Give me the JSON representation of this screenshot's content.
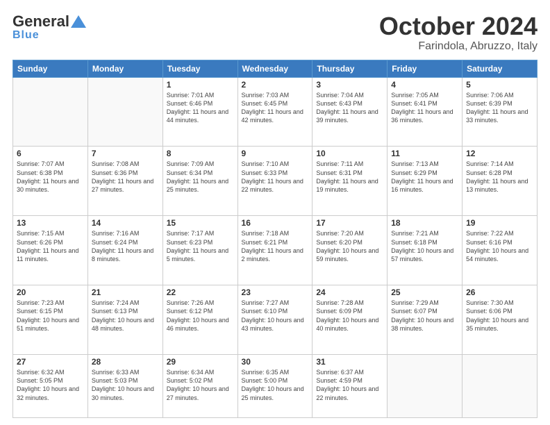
{
  "header": {
    "logo": {
      "line1": "General",
      "line2": "Blue"
    },
    "title": "October 2024",
    "subtitle": "Farindola, Abruzzo, Italy"
  },
  "weekdays": [
    "Sunday",
    "Monday",
    "Tuesday",
    "Wednesday",
    "Thursday",
    "Friday",
    "Saturday"
  ],
  "weeks": [
    [
      {
        "day": "",
        "info": ""
      },
      {
        "day": "",
        "info": ""
      },
      {
        "day": "1",
        "info": "Sunrise: 7:01 AM\nSunset: 6:46 PM\nDaylight: 11 hours and 44 minutes."
      },
      {
        "day": "2",
        "info": "Sunrise: 7:03 AM\nSunset: 6:45 PM\nDaylight: 11 hours and 42 minutes."
      },
      {
        "day": "3",
        "info": "Sunrise: 7:04 AM\nSunset: 6:43 PM\nDaylight: 11 hours and 39 minutes."
      },
      {
        "day": "4",
        "info": "Sunrise: 7:05 AM\nSunset: 6:41 PM\nDaylight: 11 hours and 36 minutes."
      },
      {
        "day": "5",
        "info": "Sunrise: 7:06 AM\nSunset: 6:39 PM\nDaylight: 11 hours and 33 minutes."
      }
    ],
    [
      {
        "day": "6",
        "info": "Sunrise: 7:07 AM\nSunset: 6:38 PM\nDaylight: 11 hours and 30 minutes."
      },
      {
        "day": "7",
        "info": "Sunrise: 7:08 AM\nSunset: 6:36 PM\nDaylight: 11 hours and 27 minutes."
      },
      {
        "day": "8",
        "info": "Sunrise: 7:09 AM\nSunset: 6:34 PM\nDaylight: 11 hours and 25 minutes."
      },
      {
        "day": "9",
        "info": "Sunrise: 7:10 AM\nSunset: 6:33 PM\nDaylight: 11 hours and 22 minutes."
      },
      {
        "day": "10",
        "info": "Sunrise: 7:11 AM\nSunset: 6:31 PM\nDaylight: 11 hours and 19 minutes."
      },
      {
        "day": "11",
        "info": "Sunrise: 7:13 AM\nSunset: 6:29 PM\nDaylight: 11 hours and 16 minutes."
      },
      {
        "day": "12",
        "info": "Sunrise: 7:14 AM\nSunset: 6:28 PM\nDaylight: 11 hours and 13 minutes."
      }
    ],
    [
      {
        "day": "13",
        "info": "Sunrise: 7:15 AM\nSunset: 6:26 PM\nDaylight: 11 hours and 11 minutes."
      },
      {
        "day": "14",
        "info": "Sunrise: 7:16 AM\nSunset: 6:24 PM\nDaylight: 11 hours and 8 minutes."
      },
      {
        "day": "15",
        "info": "Sunrise: 7:17 AM\nSunset: 6:23 PM\nDaylight: 11 hours and 5 minutes."
      },
      {
        "day": "16",
        "info": "Sunrise: 7:18 AM\nSunset: 6:21 PM\nDaylight: 11 hours and 2 minutes."
      },
      {
        "day": "17",
        "info": "Sunrise: 7:20 AM\nSunset: 6:20 PM\nDaylight: 10 hours and 59 minutes."
      },
      {
        "day": "18",
        "info": "Sunrise: 7:21 AM\nSunset: 6:18 PM\nDaylight: 10 hours and 57 minutes."
      },
      {
        "day": "19",
        "info": "Sunrise: 7:22 AM\nSunset: 6:16 PM\nDaylight: 10 hours and 54 minutes."
      }
    ],
    [
      {
        "day": "20",
        "info": "Sunrise: 7:23 AM\nSunset: 6:15 PM\nDaylight: 10 hours and 51 minutes."
      },
      {
        "day": "21",
        "info": "Sunrise: 7:24 AM\nSunset: 6:13 PM\nDaylight: 10 hours and 48 minutes."
      },
      {
        "day": "22",
        "info": "Sunrise: 7:26 AM\nSunset: 6:12 PM\nDaylight: 10 hours and 46 minutes."
      },
      {
        "day": "23",
        "info": "Sunrise: 7:27 AM\nSunset: 6:10 PM\nDaylight: 10 hours and 43 minutes."
      },
      {
        "day": "24",
        "info": "Sunrise: 7:28 AM\nSunset: 6:09 PM\nDaylight: 10 hours and 40 minutes."
      },
      {
        "day": "25",
        "info": "Sunrise: 7:29 AM\nSunset: 6:07 PM\nDaylight: 10 hours and 38 minutes."
      },
      {
        "day": "26",
        "info": "Sunrise: 7:30 AM\nSunset: 6:06 PM\nDaylight: 10 hours and 35 minutes."
      }
    ],
    [
      {
        "day": "27",
        "info": "Sunrise: 6:32 AM\nSunset: 5:05 PM\nDaylight: 10 hours and 32 minutes."
      },
      {
        "day": "28",
        "info": "Sunrise: 6:33 AM\nSunset: 5:03 PM\nDaylight: 10 hours and 30 minutes."
      },
      {
        "day": "29",
        "info": "Sunrise: 6:34 AM\nSunset: 5:02 PM\nDaylight: 10 hours and 27 minutes."
      },
      {
        "day": "30",
        "info": "Sunrise: 6:35 AM\nSunset: 5:00 PM\nDaylight: 10 hours and 25 minutes."
      },
      {
        "day": "31",
        "info": "Sunrise: 6:37 AM\nSunset: 4:59 PM\nDaylight: 10 hours and 22 minutes."
      },
      {
        "day": "",
        "info": ""
      },
      {
        "day": "",
        "info": ""
      }
    ]
  ]
}
